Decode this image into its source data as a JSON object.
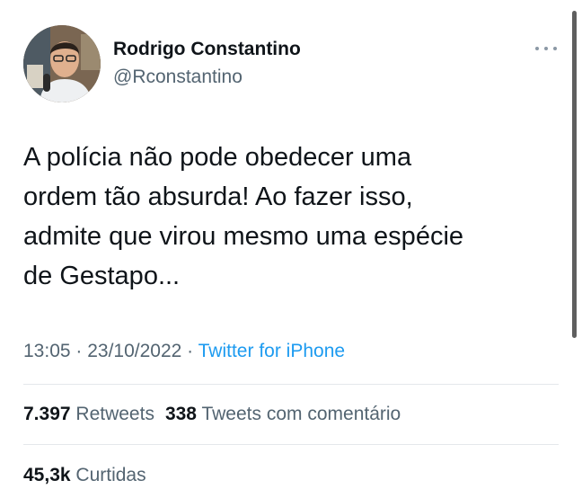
{
  "author": {
    "name": "Rodrigo Constantino",
    "handle": "@Rconstantino",
    "avatar_icon": "user-avatar"
  },
  "tweet": {
    "lines": [
      "A polícia não pode obedecer uma",
      "ordem tão absurda! Ao fazer isso,",
      "admite que virou mesmo uma espécie",
      "de Gestapo..."
    ]
  },
  "meta": {
    "time": "13:05",
    "separator": " · ",
    "date": "23/10/2022",
    "separator2": " · ",
    "source": "Twitter for iPhone"
  },
  "stats": {
    "retweets_count": "7.397",
    "retweets_label": "Retweets",
    "quotes_count": "338",
    "quotes_label": "Tweets com comentário",
    "likes_count": "45,3k",
    "likes_label": "Curtidas"
  },
  "colors": {
    "text": "#0f1419",
    "secondary": "#536471",
    "link": "#1d9bf0",
    "divider": "#e4e8eb"
  },
  "icons": {
    "more": "more-horizontal-icon"
  }
}
